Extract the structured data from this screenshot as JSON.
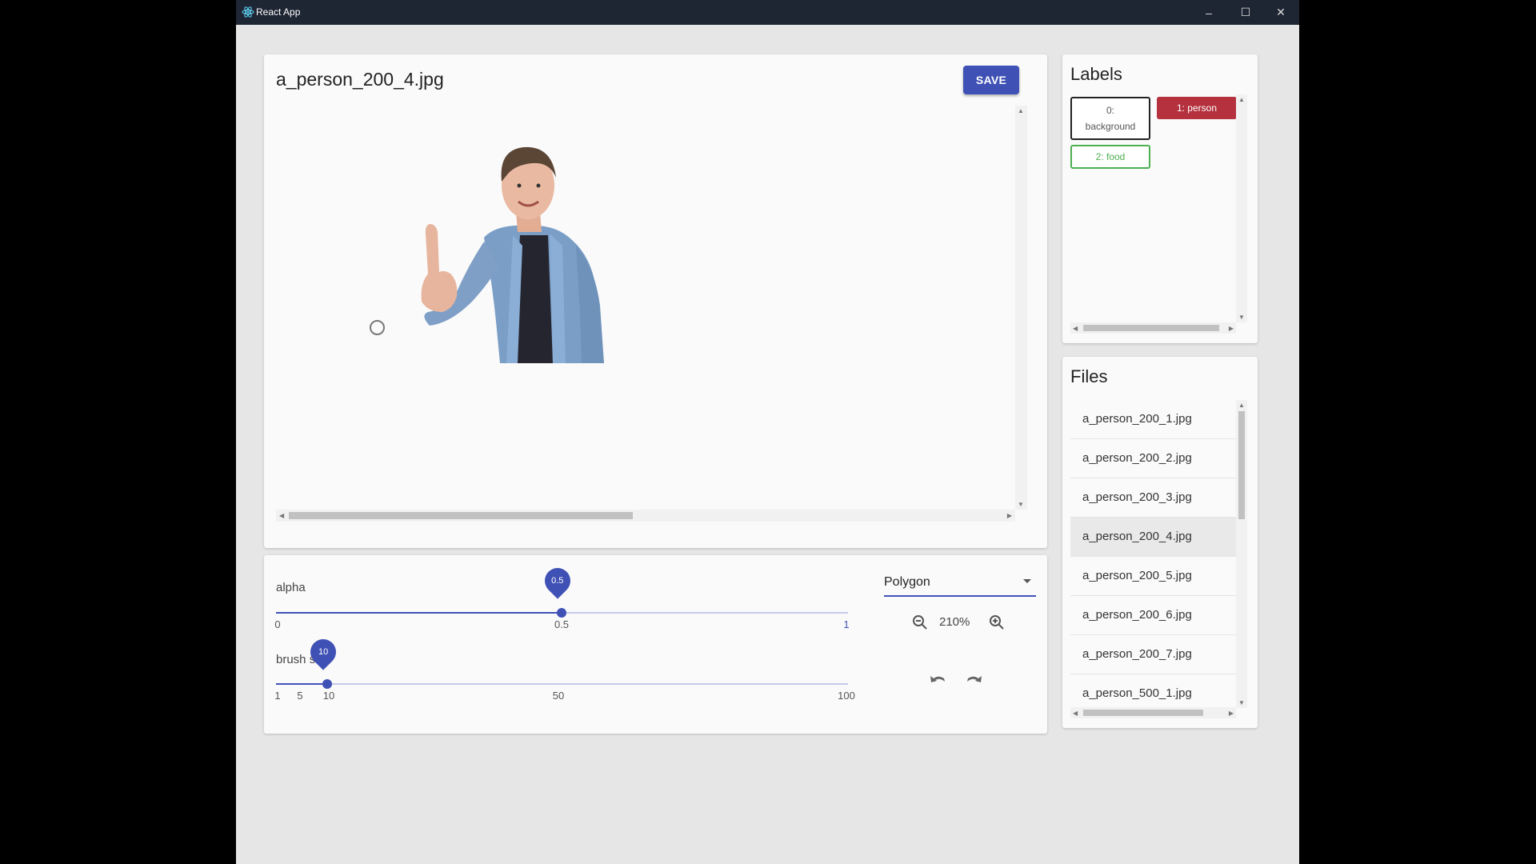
{
  "window": {
    "title": "React App",
    "controls": {
      "minimize": "–",
      "maximize": "☐",
      "close": "✕"
    }
  },
  "editor": {
    "file_title": "a_person_200_4.jpg",
    "save_label": "SAVE",
    "image_alt": "person giving thumbs up"
  },
  "controls": {
    "alpha": {
      "label": "alpha",
      "value": 0.5,
      "value_text": "0.5",
      "marks": [
        "0",
        "0.5",
        "1"
      ]
    },
    "brush": {
      "label": "brush size",
      "value": 10,
      "value_text": "10",
      "marks": [
        "1",
        "5",
        "10",
        "50",
        "100"
      ]
    },
    "tool": {
      "selected": "Polygon"
    },
    "zoom": {
      "value": "210%"
    },
    "accent_color": "#3f51b5"
  },
  "labels": {
    "heading": "Labels",
    "items": [
      {
        "id": "0",
        "name": "background",
        "display": "0: background",
        "color": "#222222"
      },
      {
        "id": "1",
        "name": "person",
        "display": "1: person",
        "color": "#b5313d"
      },
      {
        "id": "2",
        "name": "food",
        "display": "2: food",
        "color": "#4caf50"
      }
    ]
  },
  "files": {
    "heading": "Files",
    "items": [
      "a_person_200_1.jpg",
      "a_person_200_2.jpg",
      "a_person_200_3.jpg",
      "a_person_200_4.jpg",
      "a_person_200_5.jpg",
      "a_person_200_6.jpg",
      "a_person_200_7.jpg",
      "a_person_500_1.jpg"
    ],
    "selected": "a_person_200_4.jpg"
  }
}
